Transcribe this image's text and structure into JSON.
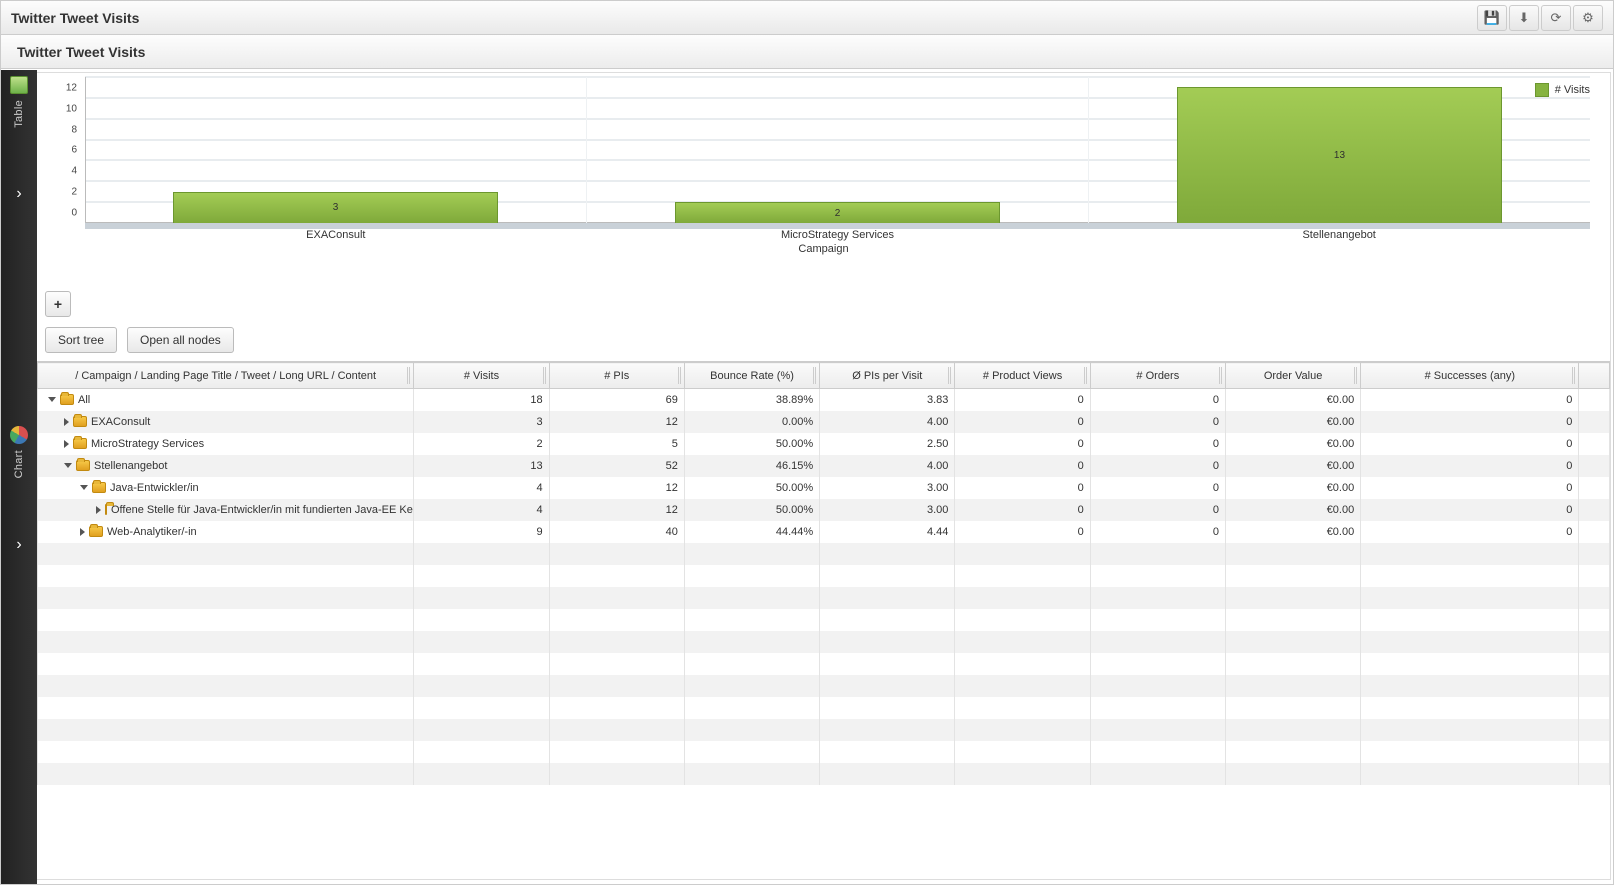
{
  "window": {
    "title": "Twitter Tweet Visits"
  },
  "sub": {
    "title": "Twitter Tweet Visits"
  },
  "toolbar": {
    "save_title": "Save",
    "download_title": "Download",
    "refresh_title": "Refresh",
    "settings_title": "Settings"
  },
  "sidebar": {
    "tabs": [
      {
        "label": "Table",
        "icon_color": "#6fb24a"
      },
      {
        "label": "Chart",
        "icon_color": "conic"
      }
    ],
    "expand_icon": "›"
  },
  "chart_data": {
    "type": "bar",
    "title": "",
    "xlabel": "Campaign",
    "ylabel": "",
    "legend": "# Visits",
    "categories": [
      "EXAConsult",
      "MicroStrategy Services",
      "Stellenangebot"
    ],
    "values": [
      3,
      2,
      13
    ],
    "ylim": [
      0,
      14
    ],
    "yticks": [
      0,
      2,
      4,
      6,
      8,
      10,
      12,
      14
    ]
  },
  "buttons": {
    "add": "+",
    "sort_tree": "Sort tree",
    "open_all": "Open all nodes"
  },
  "table": {
    "columns": [
      "/ Campaign / Landing Page Title / Tweet / Long URL / Content",
      "# Visits",
      "# PIs",
      "Bounce Rate (%)",
      "Ø PIs per Visit",
      "# Product Views",
      "# Orders",
      "Order Value",
      "# Successes (any)"
    ],
    "rows": [
      {
        "indent": 0,
        "expanded": true,
        "label": "All",
        "v": [
          "18",
          "69",
          "38.89%",
          "3.83",
          "0",
          "0",
          "€0.00",
          "0"
        ]
      },
      {
        "indent": 1,
        "expanded": false,
        "label": "EXAConsult",
        "v": [
          "3",
          "12",
          "0.00%",
          "4.00",
          "0",
          "0",
          "€0.00",
          "0"
        ]
      },
      {
        "indent": 1,
        "expanded": false,
        "label": "MicroStrategy Services",
        "v": [
          "2",
          "5",
          "50.00%",
          "2.50",
          "0",
          "0",
          "€0.00",
          "0"
        ]
      },
      {
        "indent": 1,
        "expanded": true,
        "label": "Stellenangebot",
        "v": [
          "13",
          "52",
          "46.15%",
          "4.00",
          "0",
          "0",
          "€0.00",
          "0"
        ]
      },
      {
        "indent": 2,
        "expanded": true,
        "label": "Java-Entwickler/in",
        "v": [
          "4",
          "12",
          "50.00%",
          "3.00",
          "0",
          "0",
          "€0.00",
          "0"
        ]
      },
      {
        "indent": 3,
        "expanded": false,
        "label": "Offene Stelle für Java-Entwickler/in mit fundierten Java-EE Kenntnis",
        "v": [
          "4",
          "12",
          "50.00%",
          "3.00",
          "0",
          "0",
          "€0.00",
          "0"
        ]
      },
      {
        "indent": 2,
        "expanded": false,
        "label": "Web-Analytiker/-in",
        "v": [
          "9",
          "40",
          "44.44%",
          "4.44",
          "0",
          "0",
          "€0.00",
          "0"
        ]
      }
    ],
    "empty_rows": 11
  }
}
